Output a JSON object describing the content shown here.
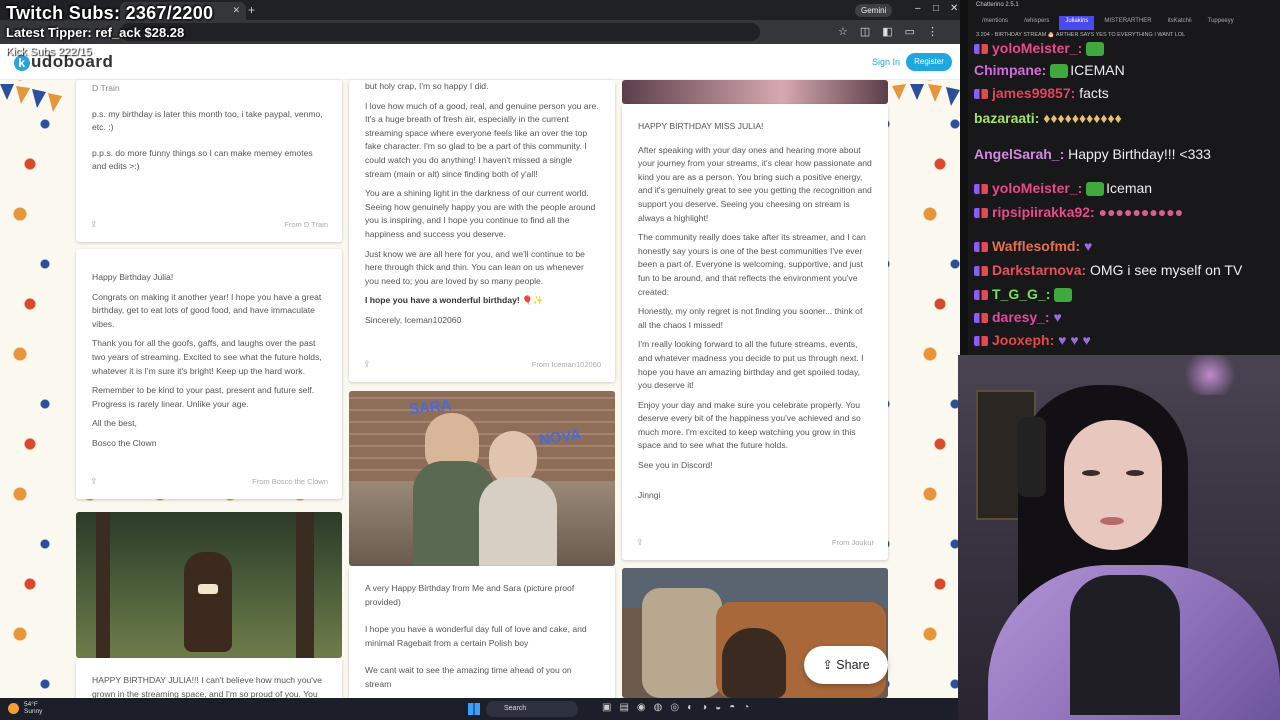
{
  "overlay": {
    "twitch_subs": "Twitch Subs: 2367/2200",
    "latest_tipper": "Latest Tipper: ref_ack  $28.28",
    "kick_subs": "Kick Subs 222/15"
  },
  "browser": {
    "gemini_label": "Gemini",
    "window_controls": [
      "–",
      "□",
      "✕"
    ]
  },
  "site": {
    "logo_rest": "udoboard",
    "logo_k": "k",
    "signin": "Sign In",
    "register": "Register",
    "share": "Share"
  },
  "cards": {
    "c1": {
      "top": "D Train",
      "p1": "p.s. my birthday is later this month too, i take paypal, venmo, etc. :)",
      "p2": "p.p.s. do more funny things so I can make memey emotes and edits >:)",
      "from": "From D Train"
    },
    "c2": {
      "p1": "Happy Birthday Julia!",
      "p2": "Congrats on making it another year! I hope you have a great birthday, get to eat lots of good food, and have immaculate vibes.",
      "p3": "Thank you for all the goofs, gaffs, and laughs over the past two years of streaming. Excited to see what the future holds, whatever it is I'm sure it's bright! Keep up the hard work.",
      "p4": "Remember to be kind to your past, present and future self. Progress is rarely linear. Unlike your age.",
      "p5": "All the best,",
      "p6": "Bosco the Clown",
      "from": "From Bosco the Clown"
    },
    "c3": {
      "p1": "HAPPY BIRTHDAY JULIA!!! I can't believe how much you've grown in the streaming space, and I'm so proud of you. You"
    },
    "c4": {
      "p0": "but holy crap, I'm so happy I did.",
      "p1": "I love how much of a good, real, and genuine person you are. It's a huge breath of fresh air, especially in the current streaming space where everyone feels like an over the top fake character. I'm so glad to be a part of this community. I could watch you do anything! I haven't missed a single stream (main or alt) since finding both of y'all!",
      "p2": "You are a shining light in the darkness of our current world. Seeing how genuinely happy you are with the people around you is inspiring, and I hope you continue to find all the happiness and success you deserve.",
      "p3": "Just know we are all here for you, and we'll continue to be here through thick and thin. You can lean on us whenever you need to; you are loved by so many people.",
      "p4": "I hope you have a wonderful birthday! 🎈✨",
      "p5": "Sincerely, Iceman102060",
      "from": "From Iceman102060"
    },
    "photo_sara": "SARA",
    "photo_nova": "NOVA",
    "c5": {
      "p1": "A very Happy Birthday from Me and Sara (picture proof provided)",
      "p2": "I hope you have a wonderful day full of love and cake, and minimal Ragebait from a certain Polish boy",
      "p3": "We cant wait to see the amazing time ahead of you on stream"
    },
    "c6": {
      "p1": "HAPPY BIRTHDAY MISS JULIA!",
      "p2": "After speaking with your day ones and hearing more about your journey from your streams, it's clear how passionate and kind you are as a person. You bring such a positive energy, and it's genuinely great to see you getting the recognition and support you deserve. Seeing you cheesing on stream is always a highlight!",
      "p3": "The community really does take after its streamer, and I can honestly say yours is one of the best communities I've ever been a part of. Everyone is welcoming, supportive, and just fun to be around, and that reflects the environment you've created.",
      "p4": "Honestly, my only regret is not finding you sooner... think of all the chaos I missed!",
      "p5": "I'm really looking forward to all the future streams, events, and whatever madness you decide to put us through next. I hope you have an amazing birthday and get spoiled today, you deserve it!",
      "p6": "Enjoy your day and make sure you celebrate properly. You deserve every bit of the happiness you've achieved and so much more. I'm excited to keep watching you grow in this space and to see what the future holds.",
      "p7": "See you in Discord!",
      "p8": "Jinngi",
      "from": "From Joukur"
    }
  },
  "taskbar": {
    "temp": "54°F",
    "weather": "Sunny",
    "search": "Search"
  },
  "chat": {
    "title": "Chatterino 2.5.1",
    "tabs": [
      "/mentions",
      "/whispers",
      "Juliakins",
      "MISTERARTHER",
      "itsKatchii",
      "Tuppeeyy"
    ],
    "banner": "3.204 - BIRTHDAY STREAM 🎂 ARTHER SAYS YES TO EVERYTHING I WANT LOL",
    "messages": [
      {
        "user": "yoloMeister_:",
        "text": "",
        "color": "#e84a8a"
      },
      {
        "user": "Chimpane:",
        "text": "ICEMAN",
        "color": "#d66ae0"
      },
      {
        "user": "james99857:",
        "text": "facts",
        "color": "#e0455a"
      },
      {
        "user": "bazaraati:",
        "text": "",
        "color": "#a4e06a"
      },
      {
        "user": "AngelSarah_:",
        "text": "Happy Birthday!!! <333",
        "color": "#d08ae0"
      },
      {
        "user": "yoloMeister_:",
        "text": "Iceman",
        "color": "#e84a8a"
      },
      {
        "user": "ripsipiirakka92:",
        "text": "",
        "color": "#e84a8a"
      },
      {
        "user": "Wafflesofmd:",
        "text": "",
        "color": "#e87050"
      },
      {
        "user": "Darkstarnova:",
        "text": "OMG i see myself on TV",
        "color": "#e8505a"
      },
      {
        "user": "T_G_G_:",
        "text": "",
        "color": "#7ae05a"
      },
      {
        "user": "daresy_:",
        "text": "",
        "color": "#e04aa0"
      },
      {
        "user": "Jooxeph:",
        "text": "",
        "color": "#e04a4a"
      }
    ]
  }
}
